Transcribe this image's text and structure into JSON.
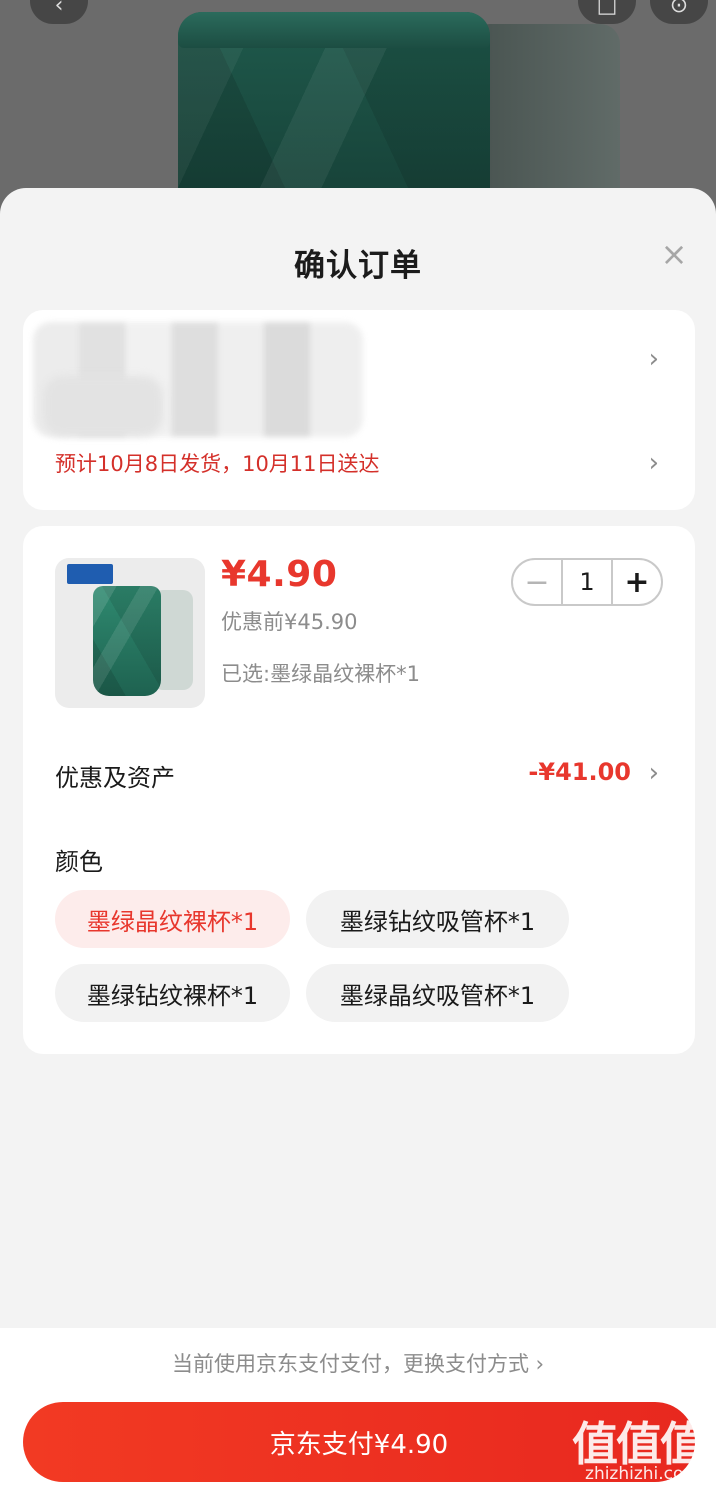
{
  "sheet": {
    "title": "确认订单",
    "close_icon": "×"
  },
  "address": {
    "delivery_text": "预计10月8日发货，10月11日送达"
  },
  "product": {
    "price": "¥4.90",
    "original_price": "优惠前¥45.90",
    "selected": "已选:墨绿晶纹裸杯*1",
    "quantity": "1",
    "minus": "−",
    "plus": "+"
  },
  "discount": {
    "label": "优惠及资产",
    "value": "-¥41.00"
  },
  "color": {
    "label": "颜色",
    "options": [
      "墨绿晶纹裸杯*1",
      "墨绿钻纹吸管杯*1",
      "墨绿钻纹裸杯*1",
      "墨绿晶纹吸管杯*1"
    ],
    "selected_index": 0
  },
  "payment": {
    "note": "当前使用京东支付支付，更换支付方式 ›",
    "button": "京东支付¥4.90"
  },
  "watermark": {
    "logo": "值值值",
    "site": "zhizhizhi.com"
  },
  "colors": {
    "accent": "#e8372d",
    "chip_active_bg": "#fdeceb"
  }
}
